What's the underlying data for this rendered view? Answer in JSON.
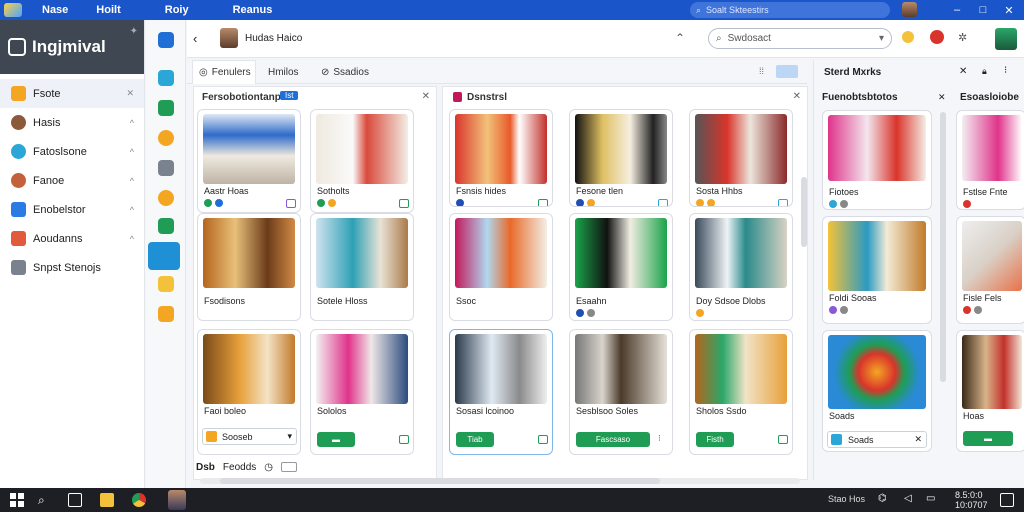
{
  "titlebar": {
    "menus": [
      "Nase",
      "Hoilt",
      "Roiy",
      "Reanus"
    ],
    "search_placeholder": "Soalt Skteestirs",
    "controls": [
      "–",
      "□",
      "✕"
    ]
  },
  "sidebar": {
    "app_title": "Ingjmival",
    "items": [
      {
        "label": "Fsote",
        "icon": "folder-icon",
        "color": "#f4a623",
        "arrow": "✕"
      },
      {
        "label": "Hasis",
        "icon": "avatar-icon",
        "color": "#8a5a3b"
      },
      {
        "label": "Fatoslsone",
        "icon": "globe-icon",
        "color": "#2aa7d6"
      },
      {
        "label": "Fanoe",
        "icon": "people-icon",
        "color": "#c2613a"
      },
      {
        "label": "Enobelstor",
        "icon": "calendar-icon",
        "color": "#2c7be5"
      },
      {
        "label": "Aoudanns",
        "icon": "apps-icon",
        "color": "#e25a3c"
      },
      {
        "label": "Snpst Stenojs",
        "icon": "list-icon",
        "color": "#7a8290"
      }
    ]
  },
  "toolbar": {
    "title": "Hudas Haico",
    "search_placeholder": "Swdosact"
  },
  "tabs": [
    {
      "label": "Fenulers"
    },
    {
      "label": "Hmilos"
    },
    {
      "label": "Ssadios"
    }
  ],
  "left_panel": {
    "title": "Fersobotiontanps",
    "badge": "Ist",
    "cards": [
      {
        "label": "Aastr Hoas"
      },
      {
        "label": "Sotholts"
      },
      {
        "label": "Fsodisons"
      },
      {
        "label": "Sotele Hloss"
      },
      {
        "label": "Faoi boleo"
      },
      {
        "label": "Sololos"
      }
    ],
    "button": "Sooseb"
  },
  "middle_panel": {
    "title": "Dsnstrsl",
    "cards": [
      {
        "label": "Fsnsis hides"
      },
      {
        "label": "Fesone tlen"
      },
      {
        "label": "Sosta Hhbs"
      },
      {
        "label": "Ssoc"
      },
      {
        "label": "Esaahn"
      },
      {
        "label": "Doy Sdsoe Dlobs"
      },
      {
        "label": "Sosasi lcoinoo"
      },
      {
        "label": "Sesblsoo Soles"
      },
      {
        "label": "Sholos Ssdo"
      }
    ],
    "buttons": [
      "Tiab",
      "Fascsaso",
      "Fisth"
    ]
  },
  "footer": {
    "left": "Dsb",
    "right": "Feodds"
  },
  "right_panel": {
    "title": "Sterd Mxrks",
    "col1_title": "Fuenobtsbtotos",
    "col2_title": "Esoasloiobe",
    "cards": [
      {
        "label": "Fiotoes"
      },
      {
        "label": "Foldi Sooas"
      },
      {
        "label": "Soads"
      }
    ],
    "col2_cards": [
      {
        "label": "Fstlse Fnte"
      },
      {
        "label": "Fisle Fels"
      },
      {
        "label": "Hoas"
      }
    ]
  },
  "taskbar": {
    "status_text": "Stao Hos",
    "time": "8.5:0:0",
    "date": "10:0707"
  }
}
